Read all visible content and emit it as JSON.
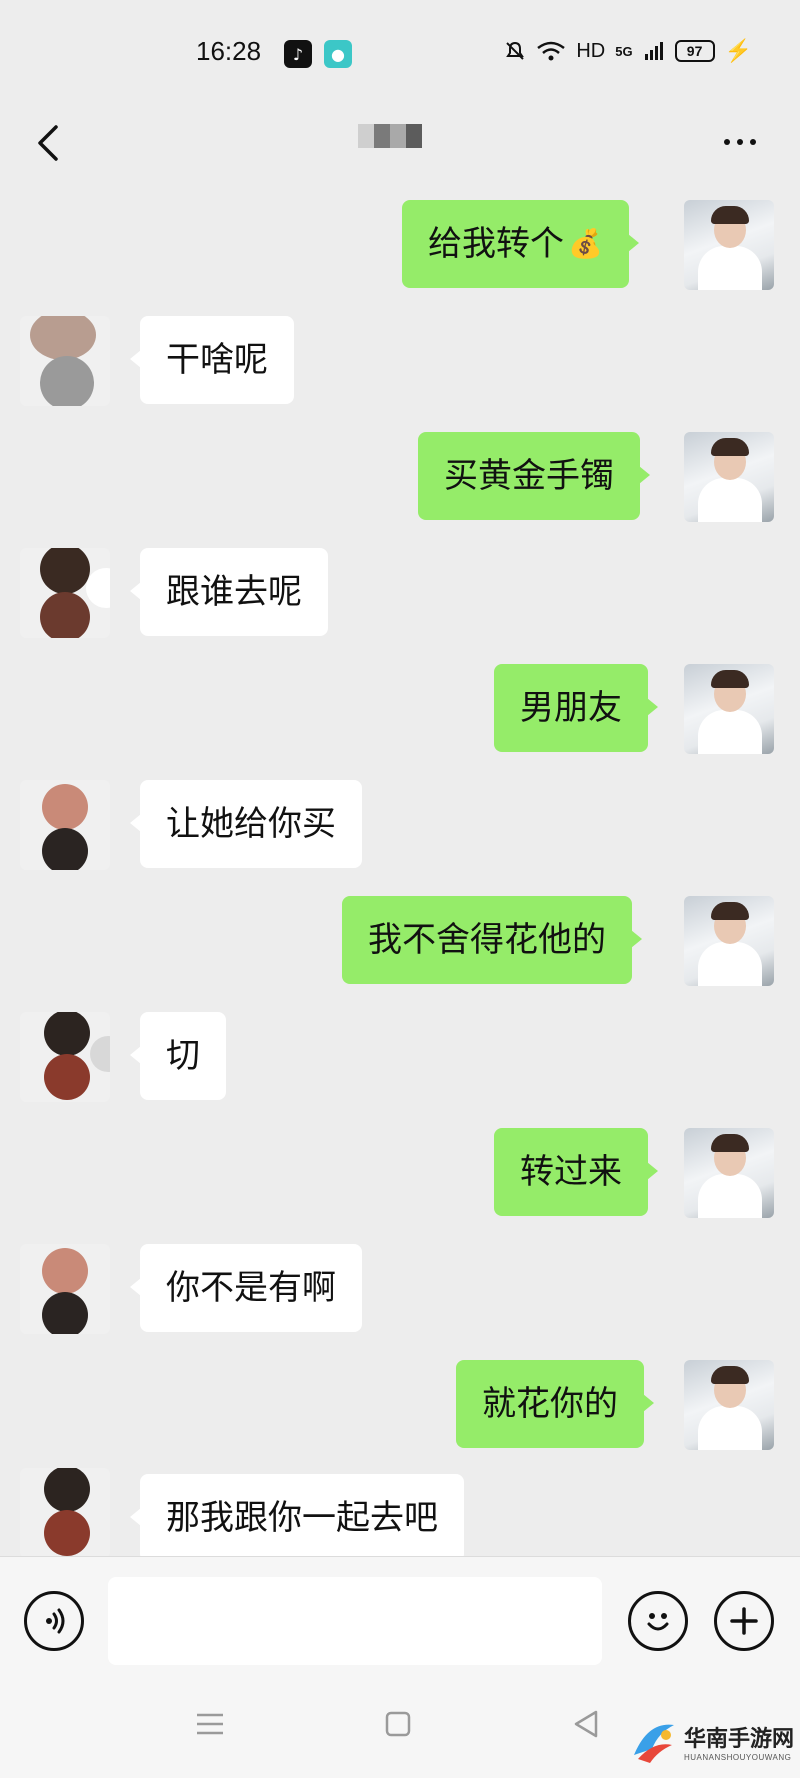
{
  "status_bar": {
    "time": "16:28",
    "network": "HD",
    "signal": "5G",
    "battery": "97"
  },
  "header": {
    "back_icon": "chevron-left-icon",
    "more_icon": "more-dots-icon"
  },
  "messages": [
    {
      "side": "sent",
      "text": "给我转个",
      "emoji": "💰"
    },
    {
      "side": "recv",
      "text": "干啥呢"
    },
    {
      "side": "sent",
      "text": "买黄金手镯"
    },
    {
      "side": "recv",
      "text": "跟谁去呢"
    },
    {
      "side": "sent",
      "text": "男朋友"
    },
    {
      "side": "recv",
      "text": "让她给你买"
    },
    {
      "side": "sent",
      "text": "我不舍得花他的"
    },
    {
      "side": "recv",
      "text": "切"
    },
    {
      "side": "sent",
      "text": "转过来"
    },
    {
      "side": "recv",
      "text": "你不是有啊"
    },
    {
      "side": "sent",
      "text": "就花你的"
    },
    {
      "side": "recv",
      "text": "那我跟你一起去吧"
    }
  ],
  "input_bar": {
    "voice_icon": "voice-icon",
    "input_value": "",
    "emoji_icon": "emoji-icon",
    "plus_icon": "plus-icon"
  },
  "nav_bar": {
    "menu_icon": "menu-icon",
    "home_icon": "home-square-icon",
    "back_icon": "back-triangle-icon"
  },
  "watermark": {
    "cn": "华南手游网",
    "en": "HUANANSHOUYOUWANG"
  },
  "colors": {
    "background": "#ededed",
    "sent_bubble": "#95ec69",
    "recv_bubble": "#ffffff"
  }
}
